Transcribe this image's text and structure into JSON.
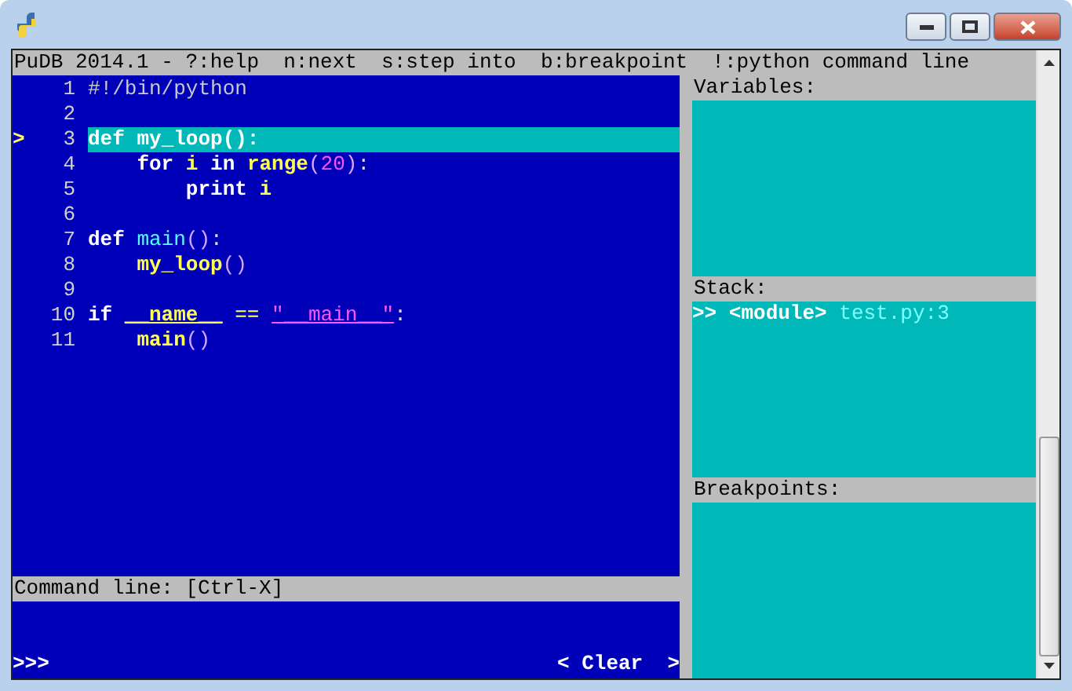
{
  "header": "PuDB 2014.1 - ?:help  n:next  s:step into  b:breakpoint  !:python command line",
  "code": [
    {
      "number": "1",
      "current": false,
      "tokens": [
        {
          "kind": "comment",
          "text": "#!/bin/python"
        }
      ]
    },
    {
      "number": "2",
      "current": false
    },
    {
      "number": "3",
      "current": true,
      "marker": ">",
      "tokens": [
        {
          "kind": "keyword",
          "text": "def "
        },
        {
          "kind": "name",
          "text": "my_loop"
        },
        {
          "kind": "punct",
          "text": "():"
        }
      ]
    },
    {
      "number": "4",
      "current": false,
      "tokens": [
        {
          "kind": "keyword",
          "text": "    for "
        },
        {
          "kind": "name",
          "text": "i "
        },
        {
          "kind": "keyword",
          "text": "in "
        },
        {
          "kind": "name",
          "text": "range"
        },
        {
          "kind": "paren",
          "text": "("
        },
        {
          "kind": "number",
          "text": "20"
        },
        {
          "kind": "paren",
          "text": ")"
        },
        {
          "kind": "punct",
          "text": ":"
        }
      ]
    },
    {
      "number": "5",
      "current": false,
      "tokens": [
        {
          "kind": "keyword",
          "text": "        print "
        },
        {
          "kind": "name",
          "text": "i"
        }
      ]
    },
    {
      "number": "6",
      "current": false
    },
    {
      "number": "7",
      "current": false,
      "tokens": [
        {
          "kind": "keyword",
          "text": "def "
        },
        {
          "kind": "defname",
          "text": "main"
        },
        {
          "kind": "paren",
          "text": "()"
        },
        {
          "kind": "punct",
          "text": ":"
        }
      ]
    },
    {
      "number": "8",
      "current": false,
      "tokens": [
        {
          "kind": "name",
          "text": "    my_loop"
        },
        {
          "kind": "paren",
          "text": "()"
        }
      ]
    },
    {
      "number": "9",
      "current": false
    },
    {
      "number": "10",
      "current": false,
      "tokens": [
        {
          "kind": "keyword",
          "text": "if "
        },
        {
          "kind": "dunder",
          "text": "__name__"
        },
        {
          "kind": "operator",
          "text": " == "
        },
        {
          "kind": "string",
          "text": "\"__main__\""
        },
        {
          "kind": "punct",
          "text": ":"
        }
      ]
    },
    {
      "number": "11",
      "current": false,
      "tokens": [
        {
          "kind": "name",
          "text": "    main"
        },
        {
          "kind": "paren",
          "text": "()"
        }
      ]
    }
  ],
  "command_line": {
    "title": "Command line: [Ctrl-X]",
    "prompt": ">>>",
    "clear_button": "< Clear  >"
  },
  "variables": {
    "title": "Variables:"
  },
  "stack": {
    "title": "Stack:",
    "frames": [
      {
        "marker": ">>",
        "function": "<module>",
        "location": "test.py:3",
        "selected": true
      }
    ]
  },
  "breakpoints": {
    "title": "Breakpoints:"
  }
}
